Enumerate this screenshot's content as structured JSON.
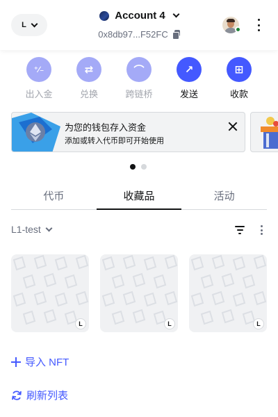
{
  "header": {
    "network_badge": "L",
    "account_name": "Account 4",
    "account_address": "0x8db97...F52FC"
  },
  "actions": [
    {
      "label": "出入金",
      "state": "disabled",
      "icon": "buy-sell-icon",
      "glyph": "⁺∕₋"
    },
    {
      "label": "兑换",
      "state": "disabled",
      "icon": "swap-icon",
      "glyph": "⇄"
    },
    {
      "label": "跨链桥",
      "state": "disabled",
      "icon": "bridge-icon",
      "glyph": "⌒"
    },
    {
      "label": "发送",
      "state": "active",
      "icon": "send-arrow-icon",
      "glyph": "↗"
    },
    {
      "label": "收款",
      "state": "active",
      "icon": "qr-code-icon",
      "glyph": "⊞"
    }
  ],
  "banner": {
    "title": "为您的钱包存入资金",
    "subtitle": "添加或转入代币即可开始使用",
    "icon": "ethereum-icon"
  },
  "carousel": {
    "total": 2,
    "active_index": 0
  },
  "tabs": [
    {
      "label": "代币",
      "active": false
    },
    {
      "label": "收藏品",
      "active": true
    },
    {
      "label": "活动",
      "active": false
    }
  ],
  "filter": {
    "network_label": "L1-test"
  },
  "nfts": [
    {
      "badge": "L"
    },
    {
      "badge": "L"
    },
    {
      "badge": "L"
    }
  ],
  "links": {
    "import_nft": "导入 NFT",
    "refresh_list": "刷新列表"
  },
  "colors": {
    "primary": "#4459ff",
    "primary_disabled": "#a4aaf7",
    "text_muted": "#686e7d",
    "border": "#d6d9dc",
    "online": "#1c8234"
  }
}
